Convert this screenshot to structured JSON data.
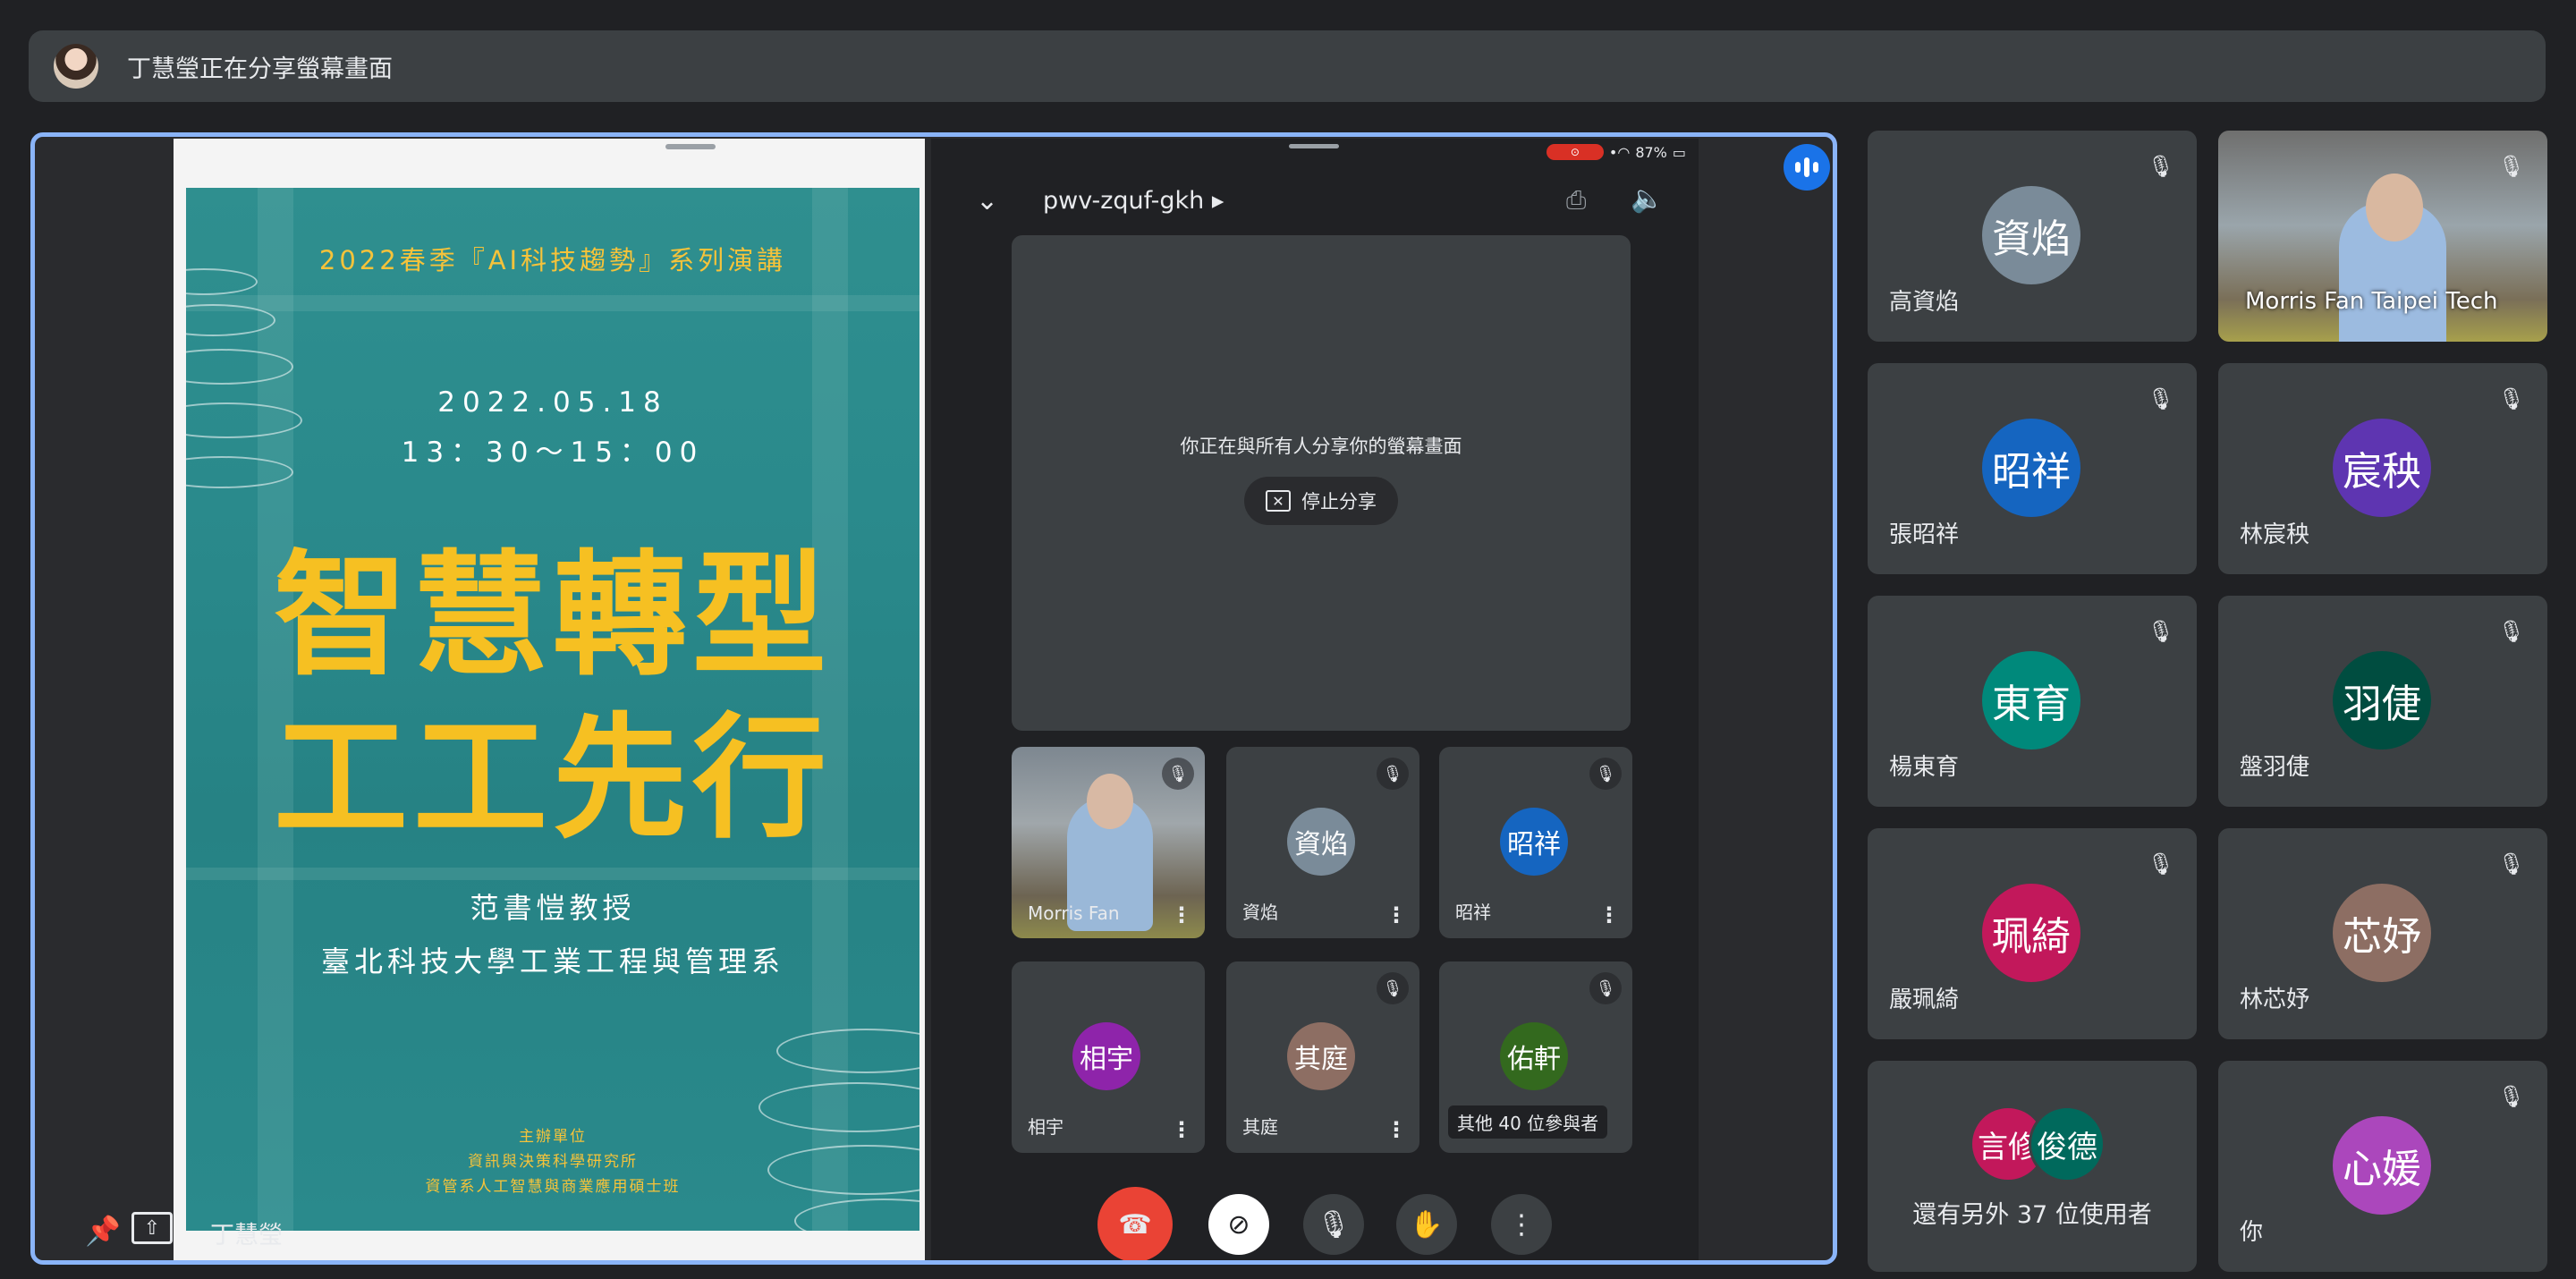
{
  "banner": {
    "text": "丁慧瑩正在分享螢幕畫面"
  },
  "poster": {
    "series_title": "2022春季『AI科技趨勢』系列演講",
    "date": "2022.05.18",
    "time": "13：30～15：00",
    "headline_1": "智慧轉型",
    "headline_2": "工工先行",
    "speaker": "范書愷教授",
    "affiliation": "臺北科技大學工業工程與管理系",
    "host_label": "主辦單位",
    "host_1": "資訊與決策科學研究所",
    "host_2": "資管系人工智慧與商業應用碩士班"
  },
  "phone": {
    "battery": "87%",
    "meeting_code": "pwv-zquf-gkh",
    "share_message": "你正在與所有人分享你的螢幕畫面",
    "stop_share": "停止分享",
    "tiles": [
      {
        "name": "Morris Fan",
        "video": true,
        "muted": true
      },
      {
        "name": "資焰",
        "avatar": "資焰",
        "color": "#7a8b99",
        "muted": true
      },
      {
        "name": "昭祥",
        "avatar": "昭祥",
        "color": "#1565c0",
        "muted": true
      },
      {
        "name": "相宇",
        "avatar": "相宇",
        "color": "#8e24aa",
        "muted": false
      },
      {
        "name": "其庭",
        "avatar": "其庭",
        "color": "#8d6e63",
        "muted": true
      },
      {
        "name": "其他 40 位參與者",
        "avatar": "佑軒",
        "color": "#33691e",
        "muted": true
      }
    ]
  },
  "presenter": {
    "name": "丁慧瑩"
  },
  "grid": [
    {
      "name": "高資焰",
      "avatar": "資焰",
      "color": "#7a8b99"
    },
    {
      "name": "Morris Fan Taipei Tech",
      "video": true
    },
    {
      "name": "張昭祥",
      "avatar": "昭祥",
      "color": "#1565c0"
    },
    {
      "name": "林宸秧",
      "avatar": "宸秧",
      "color": "#5e35b1"
    },
    {
      "name": "楊東育",
      "avatar": "東育",
      "color": "#00897b"
    },
    {
      "name": "盤羽倢",
      "avatar": "羽倢",
      "color": "#004d40"
    },
    {
      "name": "嚴珮綺",
      "avatar": "珮綺",
      "color": "#c2185b"
    },
    {
      "name": "林芯妤",
      "avatar": "芯妤",
      "color": "#8d6e63"
    },
    {
      "more": true,
      "avatars": [
        "言修",
        "俊德"
      ],
      "colors": [
        "#c2185b",
        "#00695c"
      ],
      "text": "還有另外 37 位使用者"
    },
    {
      "name": "你",
      "avatar": "心媛",
      "color": "#ab47bc"
    }
  ]
}
